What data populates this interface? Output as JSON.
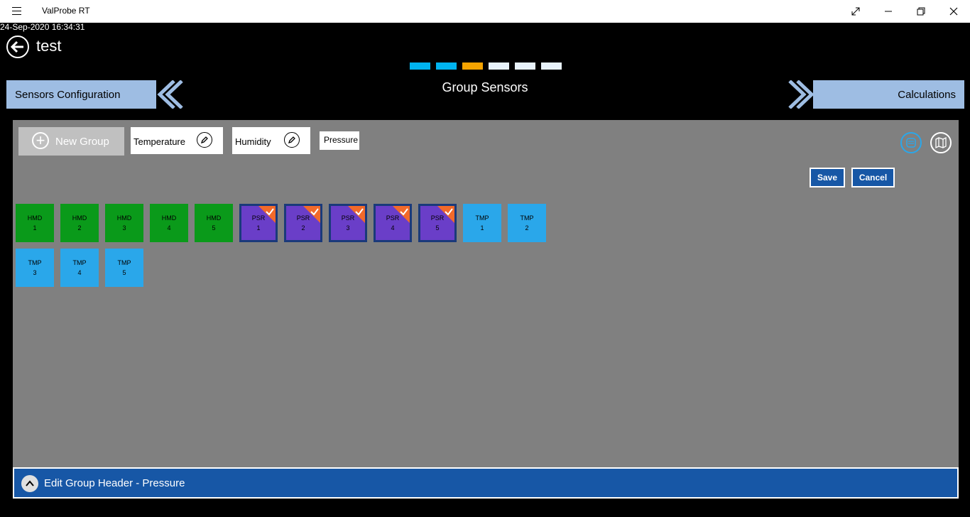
{
  "window": {
    "app_title": "ValProbe RT"
  },
  "timestamp": "24-Sep-2020 16:34:31",
  "page_title": "test",
  "progress_colors": [
    "#00b4f0",
    "#00b4f0",
    "#f5a300",
    "#e8f2fb",
    "#e8f2fb",
    "#e8f2fb"
  ],
  "nav": {
    "prev_label": "Sensors Configuration",
    "next_label": "Calculations",
    "section_title": "Group Sensors",
    "color": "#9ebde3"
  },
  "toolbar": {
    "new_group_label": "New Group",
    "groups": [
      {
        "label": "Temperature"
      },
      {
        "label": "Humidity"
      }
    ],
    "editing_group": "Pressure",
    "save_label": "Save",
    "cancel_label": "Cancel"
  },
  "sensors": [
    {
      "kind": "HMD",
      "num": "1",
      "type": "hmd"
    },
    {
      "kind": "HMD",
      "num": "2",
      "type": "hmd"
    },
    {
      "kind": "HMD",
      "num": "3",
      "type": "hmd"
    },
    {
      "kind": "HMD",
      "num": "4",
      "type": "hmd"
    },
    {
      "kind": "HMD",
      "num": "5",
      "type": "hmd"
    },
    {
      "kind": "PSR",
      "num": "1",
      "type": "psr",
      "selected": true
    },
    {
      "kind": "PSR",
      "num": "2",
      "type": "psr",
      "selected": true
    },
    {
      "kind": "PSR",
      "num": "3",
      "type": "psr",
      "selected": true
    },
    {
      "kind": "PSR",
      "num": "4",
      "type": "psr",
      "selected": true
    },
    {
      "kind": "PSR",
      "num": "5",
      "type": "psr",
      "selected": true
    },
    {
      "kind": "TMP",
      "num": "1",
      "type": "tmp"
    },
    {
      "kind": "TMP",
      "num": "2",
      "type": "tmp"
    },
    {
      "kind": "TMP",
      "num": "3",
      "type": "tmp"
    },
    {
      "kind": "TMP",
      "num": "4",
      "type": "tmp"
    },
    {
      "kind": "TMP",
      "num": "5",
      "type": "tmp"
    }
  ],
  "footer": {
    "label": "Edit Group Header - Pressure"
  }
}
